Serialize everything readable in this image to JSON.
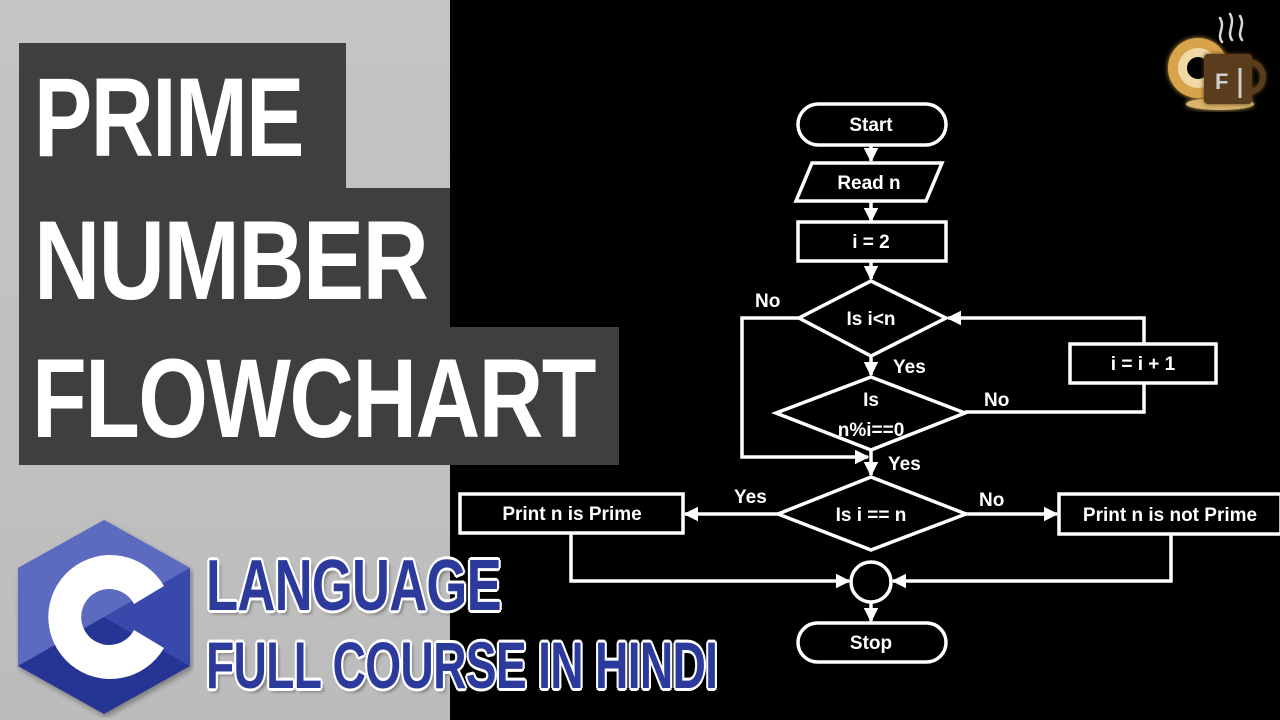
{
  "title": {
    "line1": "PRIME",
    "line2": "NUMBER",
    "line3": "FLOWCHART"
  },
  "subtitle": {
    "line1": "LANGUAGE",
    "line2": "FULL COURSE IN HINDI"
  },
  "logos": {
    "c_language": "C",
    "channel_mug_letter": "F"
  },
  "colors": {
    "panel_gray": "#c2c2c2",
    "title_block": "#3f3f3f",
    "c_blue_light": "#5c6bc0",
    "c_blue_mid": "#3f51b5",
    "c_blue_dark": "#283593",
    "subtitle_blue": "#2c3a9c",
    "flow_stroke": "#ffffff",
    "background": "#000000"
  },
  "flowchart": {
    "nodes": {
      "start": "Start",
      "read": "Read n",
      "init": "i = 2",
      "cond_loop": "Is i<n",
      "cond_mod_line1": "Is",
      "cond_mod_line2": "n%i==0",
      "increment": "i = i + 1",
      "cond_equal": "Is i == n",
      "print_prime": "Print n is Prime",
      "print_not_prime": "Print n is not Prime",
      "stop": "Stop"
    },
    "edge_labels": {
      "loop_no": "No",
      "loop_yes": "Yes",
      "mod_no": "No",
      "mod_yes": "Yes",
      "equal_yes": "Yes",
      "equal_no": "No"
    }
  }
}
